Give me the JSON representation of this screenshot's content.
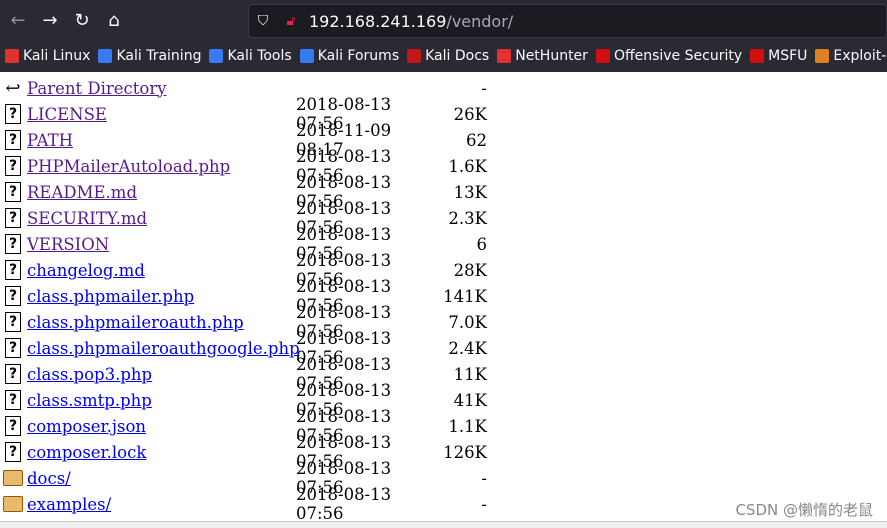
{
  "browser": {
    "url_host": "192.168.241.169",
    "url_path": "/vendor/",
    "bookmarks": [
      {
        "label": "Kali Linux",
        "color": "#e03030"
      },
      {
        "label": "Kali Training",
        "color": "#367bf0"
      },
      {
        "label": "Kali Tools",
        "color": "#367bf0"
      },
      {
        "label": "Kali Forums",
        "color": "#367bf0"
      },
      {
        "label": "Kali Docs",
        "color": "#c01818"
      },
      {
        "label": "NetHunter",
        "color": "#e03030"
      },
      {
        "label": "Offensive Security",
        "color": "#d01010"
      },
      {
        "label": "MSFU",
        "color": "#d01010"
      },
      {
        "label": "Exploit-DB",
        "color": "#e08020"
      }
    ]
  },
  "listing": {
    "parent": "Parent Directory",
    "parent_size": "-",
    "rows": [
      {
        "name": "LICENSE",
        "date": "2018-08-13 07:56",
        "size": "26K",
        "type": "file",
        "visited": true
      },
      {
        "name": "PATH",
        "date": "2018-11-09 08:17",
        "size": "62",
        "type": "file",
        "visited": true
      },
      {
        "name": "PHPMailerAutoload.php",
        "date": "2018-08-13 07:56",
        "size": "1.6K",
        "type": "file",
        "visited": true
      },
      {
        "name": "README.md",
        "date": "2018-08-13 07:56",
        "size": "13K",
        "type": "file",
        "visited": true
      },
      {
        "name": "SECURITY.md",
        "date": "2018-08-13 07:56",
        "size": "2.3K",
        "type": "file",
        "visited": true
      },
      {
        "name": "VERSION",
        "date": "2018-08-13 07:56",
        "size": "6",
        "type": "file",
        "visited": true
      },
      {
        "name": "changelog.md",
        "date": "2018-08-13 07:56",
        "size": "28K",
        "type": "file",
        "visited": false
      },
      {
        "name": "class.phpmailer.php",
        "date": "2018-08-13 07:56",
        "size": "141K",
        "type": "file",
        "visited": false
      },
      {
        "name": "class.phpmaileroauth.php",
        "date": "2018-08-13 07:56",
        "size": "7.0K",
        "type": "file",
        "visited": false
      },
      {
        "name": "class.phpmaileroauthgoogle.php",
        "date": "2018-08-13 07:56",
        "size": "2.4K",
        "type": "file",
        "visited": false
      },
      {
        "name": "class.pop3.php",
        "date": "2018-08-13 07:56",
        "size": "11K",
        "type": "file",
        "visited": false
      },
      {
        "name": "class.smtp.php",
        "date": "2018-08-13 07:56",
        "size": "41K",
        "type": "file",
        "visited": false
      },
      {
        "name": "composer.json",
        "date": "2018-08-13 07:56",
        "size": "1.1K",
        "type": "file",
        "visited": false
      },
      {
        "name": "composer.lock",
        "date": "2018-08-13 07:56",
        "size": "126K",
        "type": "file",
        "visited": false
      },
      {
        "name": "docs/",
        "date": "2018-08-13 07:56",
        "size": "-",
        "type": "folder",
        "visited": false
      },
      {
        "name": "examples/",
        "date": "2018-08-13 07:56",
        "size": "-",
        "type": "folder",
        "visited": false
      }
    ]
  },
  "watermark": "CSDN @懒惰的老鼠"
}
